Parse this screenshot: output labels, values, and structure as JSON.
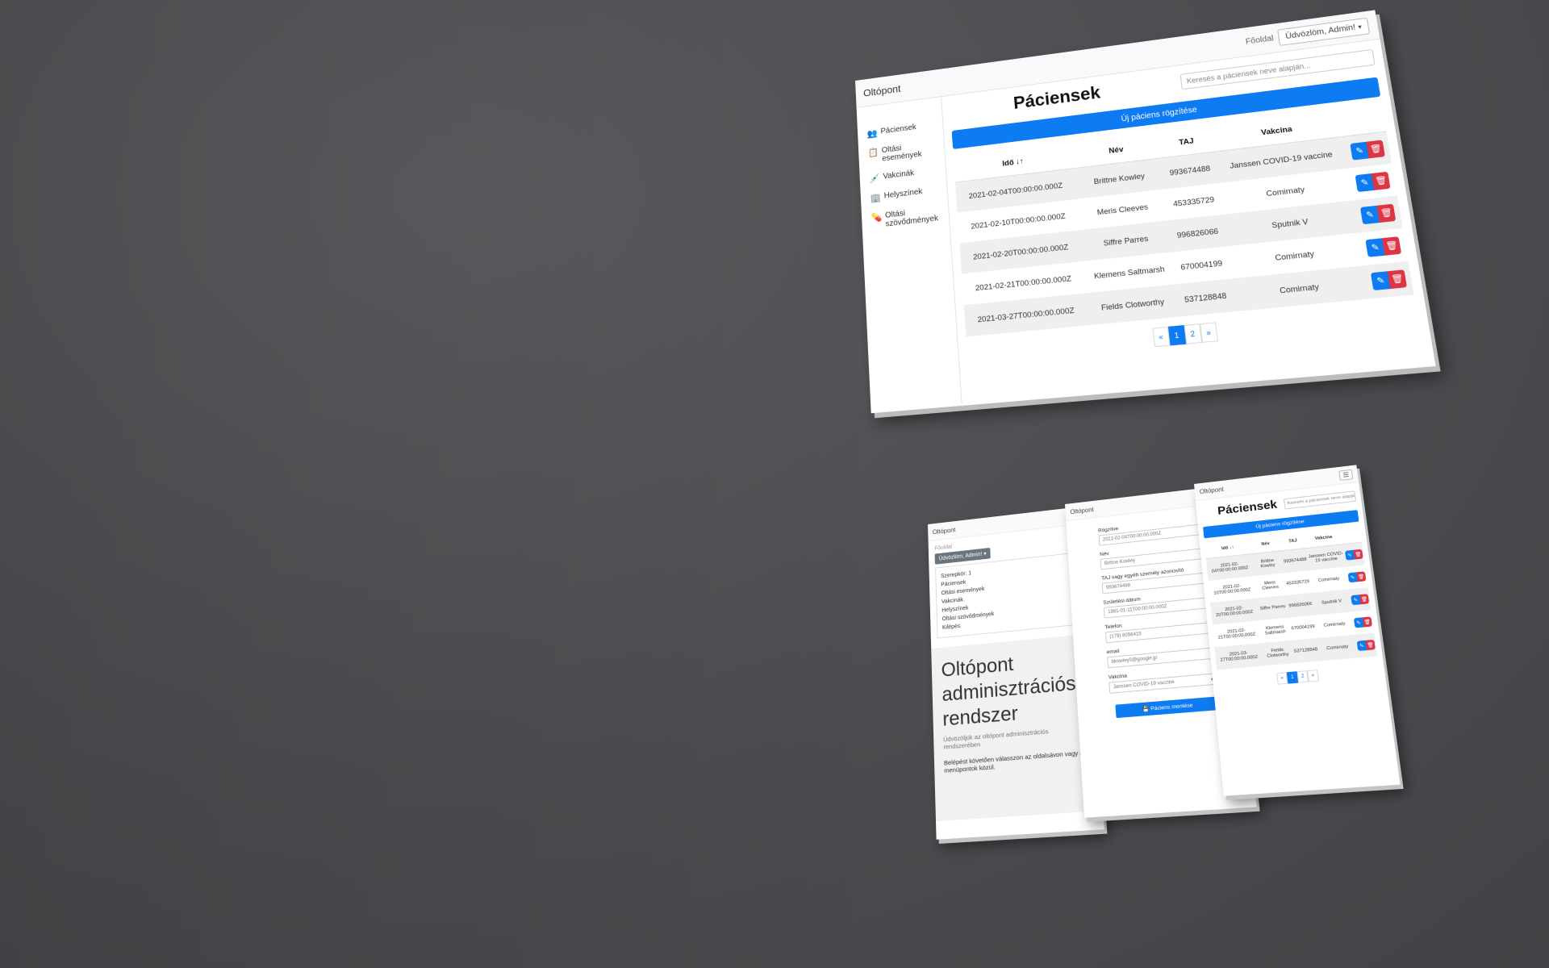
{
  "desktop": {
    "brand": "Oltópont",
    "nav_home": "Főoldal",
    "user_menu": "Üdvözlöm, Admin!",
    "sidebar": [
      {
        "label": "Páciensek",
        "icon": "users-icon"
      },
      {
        "label": "Oltási események",
        "icon": "clipboard-icon"
      },
      {
        "label": "Vakcinák",
        "icon": "syringe-icon"
      },
      {
        "label": "Helyszínek",
        "icon": "building-icon"
      },
      {
        "label": "Oltási szövődmények",
        "icon": "pill-icon"
      }
    ],
    "title": "Páciensek",
    "search_placeholder": "Keresés a páciensek neve alapján...",
    "new_button": "Új páciens rögzítése",
    "columns": [
      "Idő ↓↑",
      "Név",
      "TAJ",
      "Vakcina"
    ],
    "rows": [
      [
        "2021-02-04T00:00:00.000Z",
        "Brittne Kowley",
        "993674488",
        "Janssen COVID-19 vaccine"
      ],
      [
        "2021-02-10T00:00:00.000Z",
        "Meris Cleeves",
        "453335729",
        "Comirnaty"
      ],
      [
        "2021-02-20T00:00:00.000Z",
        "Siffre Parres",
        "996826066",
        "Sputnik V"
      ],
      [
        "2021-02-21T00:00:00.000Z",
        "Klemens Saltmarsh",
        "670004199",
        "Comirnaty"
      ],
      [
        "2021-03-27T00:00:00.000Z",
        "Fields Clotworthy",
        "537128848",
        "Comirnaty"
      ]
    ],
    "pagination": [
      "«",
      "1",
      "2",
      "»"
    ],
    "active_page": "1"
  },
  "phone_menu": {
    "brand": "Oltópont",
    "home": "Főoldal",
    "user_menu": "Üdvözlöm, Admin!",
    "items": [
      "Szerepkör: 1",
      "Páciensek",
      "Oltási események",
      "Vakcinák",
      "Helyszínek",
      "Oltási szövődmények",
      "Kilépés"
    ],
    "hero_title": "Oltópont adminisztrációs rendszer",
    "hero_sub": "Üdvözöljük az oltópont adminisztrációs rendszerében",
    "hero_desc": "Belépést követően válasszon az oldalsávon vagy a menüpontok közül."
  },
  "phone_form": {
    "brand": "Oltópont",
    "fields": [
      {
        "label": "Rögzítve",
        "value": "2021-02-04T00:00:00.000Z"
      },
      {
        "label": "Név",
        "value": "Brittne Kowley"
      },
      {
        "label": "TAJ vagy egyéb személy azonosító",
        "value": "993674488"
      },
      {
        "label": "Születési dátum",
        "value": "1981-01-11T00:00:00.000Z"
      },
      {
        "label": "Telefon",
        "value": "(179) 8056415"
      },
      {
        "label": "email",
        "value": "bkowley0@google.jp"
      },
      {
        "label": "Vakcina",
        "value": "Janssen COVID-19 vaccine"
      }
    ],
    "submit": "Páciens mentése"
  },
  "phone_list": {
    "brand": "Oltópont",
    "title": "Páciensek",
    "search_placeholder": "Keresés a páciensek neve alapján...",
    "new_button": "Új páciens rögzítése",
    "columns": [
      "Idő ↓↑",
      "Név",
      "TAJ",
      "Vakcina"
    ],
    "rows": [
      [
        "2021-02-04T00:00:00.000Z",
        "Brittne Kowley",
        "993674488",
        "Janssen COVID-19 vaccine"
      ],
      [
        "2021-02-10T00:00:00.000Z",
        "Meris Cleeves",
        "453335729",
        "Comirnaty"
      ],
      [
        "2021-02-20T00:00:00.000Z",
        "Siffre Parres",
        "996826066",
        "Sputnik V"
      ],
      [
        "2021-02-21T00:00:00.000Z",
        "Klemens Saltmarsh",
        "670004199",
        "Comirnaty"
      ],
      [
        "2021-03-27T00:00:00.000Z",
        "Fields Clotworthy",
        "537128848",
        "Comirnaty"
      ]
    ],
    "pagination": [
      "«",
      "1",
      "2",
      "»"
    ]
  },
  "colors": {
    "primary": "#0d7cf2",
    "danger": "#dc3545",
    "background": "#4a4c4f"
  }
}
